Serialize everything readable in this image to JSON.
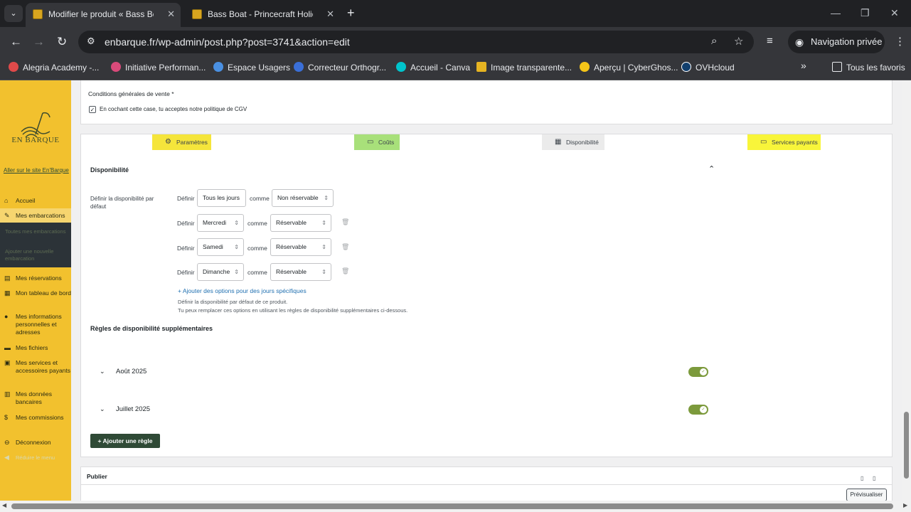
{
  "browser": {
    "tabs": [
      {
        "title": "Modifier le produit « Bass Boat",
        "active": true
      },
      {
        "title": "Bass Boat - Princecraft Holiday",
        "active": false
      }
    ],
    "new_tab": "+",
    "url": "enbarque.fr/wp-admin/post.php?post=3741&action=edit",
    "private_label": "Navigation privée",
    "bookmarks": [
      {
        "label": "Alegria Academy -...",
        "color": "#e04a4a"
      },
      {
        "label": "Initiative Performan...",
        "color": "#d94a7a"
      },
      {
        "label": "Espace Usagers",
        "color": "#4a90e2"
      },
      {
        "label": "Correcteur Orthogr...",
        "color": "#3a6fd8"
      },
      {
        "label": "Accueil - Canva",
        "color": "#00c4cc"
      },
      {
        "label": "Image transparente...",
        "color": "#e6b422"
      },
      {
        "label": "Aperçu | CyberGhos...",
        "color": "#f5c518"
      },
      {
        "label": "OVHcloud",
        "color": "#123f6d"
      }
    ],
    "bookmarks_more": "»",
    "all_bookmarks": "Tous les favoris"
  },
  "sidebar": {
    "logo_text": "EN BARQUE",
    "site_link": "Aller sur le site En'Barque",
    "menu": [
      {
        "label": "Accueil",
        "icon": "home-icon",
        "glyph": "⌂"
      },
      {
        "label": "Mes embarcations",
        "icon": "pin-icon",
        "glyph": "📌"
      },
      {
        "label": "Mes réservations",
        "icon": "list-icon",
        "glyph": "▤"
      },
      {
        "label": "Mon tableau de bord",
        "icon": "store-icon",
        "glyph": "▦"
      },
      {
        "label": "Mes informations personnelles et adresses",
        "icon": "person-icon",
        "glyph": "●"
      },
      {
        "label": "Mes fichiers",
        "icon": "folder-icon",
        "glyph": "▬"
      },
      {
        "label": "Mes services et accessoires payants",
        "icon": "cart-icon",
        "glyph": "▣"
      },
      {
        "label": "Mes données bancaires",
        "icon": "bank-icon",
        "glyph": "▥"
      },
      {
        "label": "Mes commissions",
        "icon": "dollar-icon",
        "glyph": "$"
      },
      {
        "label": "Déconnexion",
        "icon": "logout-icon",
        "glyph": "⊖"
      },
      {
        "label": "Réduire le menu",
        "icon": "collapse-icon",
        "glyph": "◀"
      }
    ],
    "submenu": [
      "Toutes mes embarcations",
      "Ajouter une nouvelle embarcation"
    ]
  },
  "cgv": {
    "title": "Conditions générales de vente *",
    "checkbox_label": "En cochant cette case, tu acceptes notre politique de CGV",
    "checked": "✓"
  },
  "product_tabs": [
    {
      "label": "Paramètres",
      "icon": "gear-icon",
      "glyph": "⚙",
      "color": "#f5e53b"
    },
    {
      "label": "Coûts",
      "icon": "money-icon",
      "glyph": "▭",
      "color": "#a8e07a"
    },
    {
      "label": "Disponibilité",
      "icon": "calendar-icon",
      "glyph": "▦",
      "color": "#ebebeb"
    },
    {
      "label": "Services payants",
      "icon": "window-icon",
      "glyph": "▭",
      "color": "#f8f53a"
    }
  ],
  "availability": {
    "title": "Disponibilité",
    "default_label": "Définir la disponibilité par défaut",
    "rows": [
      {
        "prefix": "Définir",
        "day": "Tous les jours",
        "as": "comme",
        "status": "Non réservable"
      },
      {
        "prefix": "Définir",
        "day": "Mercredi",
        "as": "comme",
        "status": "Réservable"
      },
      {
        "prefix": "Définir",
        "day": "Samedi",
        "as": "comme",
        "status": "Réservable"
      },
      {
        "prefix": "Définir",
        "day": "Dimanche",
        "as": "comme",
        "status": "Réservable"
      }
    ],
    "add_options": "+ Ajouter des options pour des jours spécifiques",
    "hint_1": "Définir la disponibilité par défaut de ce produit.",
    "hint_2": "Tu peux remplacer ces options en utilisant les règles de disponibilité supplémentaires ci-dessous."
  },
  "rules": {
    "title": "Règles de disponibilité supplémentaires",
    "items": [
      {
        "label": "Août 2025",
        "enabled": true
      },
      {
        "label": "Juillet 2025",
        "enabled": true
      }
    ],
    "add_button": "+ Ajouter une règle"
  },
  "publish": {
    "title": "Publier",
    "preview_button": "Prévisualiser"
  }
}
